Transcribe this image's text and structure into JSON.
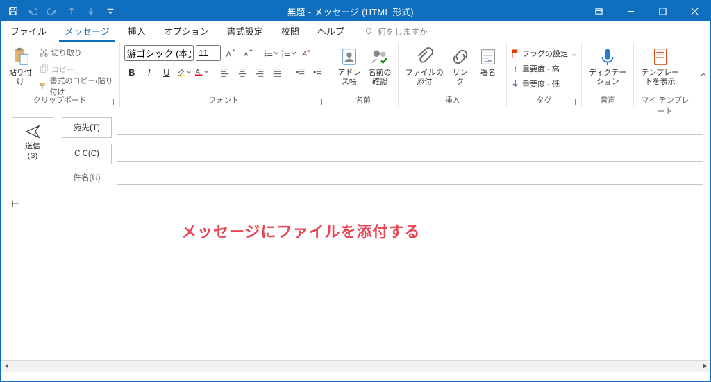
{
  "titlebar": {
    "title": "無題  -  メッセージ (HTML 形式)"
  },
  "tabs": {
    "file": "ファイル",
    "message": "メッセージ",
    "insert": "挿入",
    "options": "オプション",
    "format": "書式設定",
    "review": "校閲",
    "help": "ヘルプ",
    "tell": "何をしますか"
  },
  "ribbon": {
    "clipboard": {
      "paste": "貼り付け",
      "cut": "切り取り",
      "copy": "コピー",
      "format_painter": "書式のコピー/貼り付け",
      "label": "クリップボード"
    },
    "font": {
      "name": "游ゴシック (本文の",
      "size": "11",
      "label": "フォント"
    },
    "names": {
      "address_book": "アドレス帳",
      "check_names": "名前の\n確認",
      "label": "名前"
    },
    "include": {
      "attach_file": "ファイルの\n添付",
      "link": "リンク",
      "signature": "署名",
      "label": "挿入"
    },
    "tags": {
      "follow_up": "フラグの設定",
      "high": "重要度 - 高",
      "low": "重要度 - 低",
      "label": "タグ"
    },
    "voice": {
      "dictate": "ディクテー\nション",
      "label": "音声"
    },
    "templates": {
      "view": "テンプレー\nトを表示",
      "label": "マイ テンプレート"
    }
  },
  "compose": {
    "send": "送信\n(S)",
    "to": "宛先(T)",
    "cc": "C C(C)",
    "subject": "件名(U)"
  },
  "body": {
    "annotation": "メッセージにファイルを添付する"
  }
}
